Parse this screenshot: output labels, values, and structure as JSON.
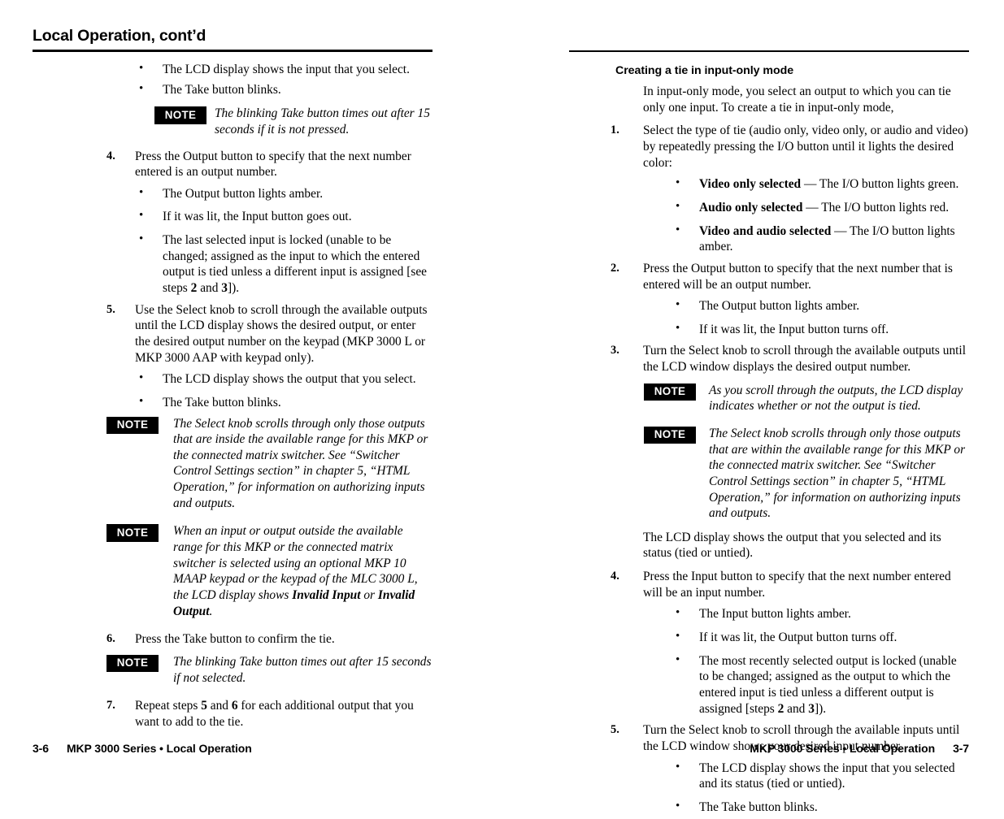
{
  "left_page": {
    "title": "Local Operation, cont’d",
    "bullets_top": [
      "The LCD display shows the input that you select.",
      "The Take button blinks."
    ],
    "note_1": {
      "badge": "NOTE",
      "text": "The blinking Take button times out after 15 seconds if it is not pressed."
    },
    "step_4": {
      "num": "4.",
      "text": "Press the Output button to specify that the next number entered is an output number."
    },
    "step_4_bullets": [
      "The Output button lights amber.",
      "If it was lit, the Input button goes out."
    ],
    "step_4_bullet_3": {
      "part1": "The last selected input is locked (unable to be changed; assigned as the input to which the entered output is tied unless a different input is assigned [see steps ",
      "bold1": "2",
      "mid": " and ",
      "bold2": "3",
      "part2": "])."
    },
    "step_5": {
      "num": "5.",
      "text": "Use the Select knob to scroll through the available outputs until the LCD display shows the desired output, or enter the desired output number on the keypad (MKP 3000 L or MKP 3000 AAP with keypad only)."
    },
    "step_5_bullets": [
      "The LCD display shows the output that you select.",
      "The Take button blinks."
    ],
    "note_2": {
      "badge": "NOTE",
      "text": "The Select knob scrolls through only those outputs that are inside the available range for this MKP or the connected matrix switcher.  See “Switcher Control Settings section” in chapter 5, “HTML Operation,” for information on authorizing inputs and outputs."
    },
    "note_3": {
      "badge": "NOTE",
      "part1": "When an input or output outside the available range for this MKP or the connected matrix switcher is selected using an optional MKP 10 MAAP keypad or the keypad of the MLC 3000 L, the LCD display shows ",
      "bold1": "Invalid Input",
      "mid": " or ",
      "bold2": "Invalid Output",
      "part2": "."
    },
    "step_6": {
      "num": "6.",
      "text": "Press the Take button to confirm the tie."
    },
    "note_4": {
      "badge": "NOTE",
      "text": "The blinking Take button times out after 15 seconds if not selected."
    },
    "step_7": {
      "num": "7.",
      "part1": "Repeat steps ",
      "bold1": "5",
      "mid": " and ",
      "bold2": "6",
      "part2": " for each additional output that you want to add to the tie."
    },
    "footer": {
      "page_number": "3-6",
      "text": "MKP 3000 Series • Local Operation"
    }
  },
  "right_page": {
    "section_heading": "Creating a tie in input-only mode",
    "intro": "In input-only mode, you select an output to which you can tie only one input.  To create a tie in input-only mode,",
    "step_1": {
      "num": "1.",
      "text": "Select the type of tie (audio only, video only, or audio and video) by repeatedly pressing the I/O button until it lights the desired color:"
    },
    "step_1_bullets": [
      {
        "bold": "Video only selected",
        "rest": " — The I/O button lights green."
      },
      {
        "bold": "Audio only selected",
        "rest": " — The I/O button lights red."
      },
      {
        "bold": "Video and audio selected",
        "rest": " — The I/O button lights amber."
      }
    ],
    "step_2": {
      "num": "2.",
      "text": "Press the Output button to specify that the next number that is entered will be an output number."
    },
    "step_2_bullets": [
      "The Output button lights amber.",
      " If it was lit, the Input button turns off."
    ],
    "step_3": {
      "num": "3.",
      "text": "Turn the Select knob to scroll through the available outputs until the LCD window displays the desired output number."
    },
    "note_1": {
      "badge": "NOTE",
      "text": "As you scroll through the outputs, the LCD display indicates whether or not the output is tied."
    },
    "note_2": {
      "badge": "NOTE",
      "text": "The Select knob scrolls through only those outputs that are within the available range for this MKP or the connected matrix switcher.  See “Switcher Control Settings section” in chapter 5, “HTML Operation,” for information on authorizing inputs and outputs."
    },
    "para_after_notes": "The LCD display shows the output that you selected and its status (tied or untied).",
    "step_4": {
      "num": "4.",
      "text": "Press the Input button to specify that the next number entered will be an input number."
    },
    "step_4_bullets": [
      "The Input button lights amber.",
      " If it was lit, the Output button turns off."
    ],
    "step_4_bullet_3": {
      "part1": "The most recently selected output is locked (unable to be changed; assigned as the output to which the entered input is tied unless a different output is assigned [steps ",
      "bold1": "2",
      "mid": " and ",
      "bold2": "3",
      "part2": "])."
    },
    "step_5": {
      "num": "5.",
      "text": "Turn the Select knob to scroll through the available inputs until the LCD window shows your desired input number."
    },
    "step_5_bullets": [
      "The LCD display shows the input that you selected and its status (tied or untied).",
      "The Take button blinks."
    ],
    "footer": {
      "page_number": "3-7",
      "text": "MKP 3000 Series • Local Operation"
    }
  },
  "glyphs": {
    "bullet": "•"
  }
}
